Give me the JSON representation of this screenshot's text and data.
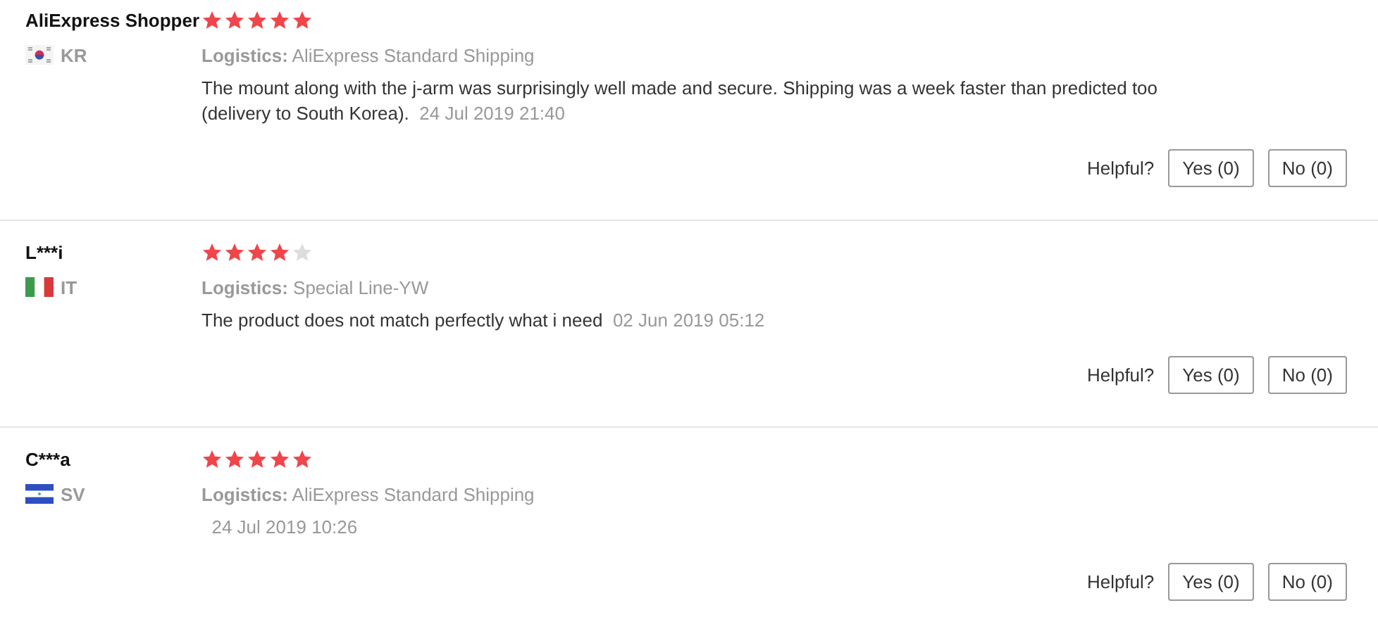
{
  "reviews": [
    {
      "name": "AliExpress Shopper",
      "stars": 5,
      "flag": {
        "kind": "kr"
      },
      "country": "KR",
      "logistics_label": "Logistics:",
      "logistics": "AliExpress Standard Shipping",
      "text": "The mount along with the j-arm was surprisingly well made and secure. Shipping was a week faster than predicted too (delivery to South Korea).",
      "date": "24 Jul 2019 21:40",
      "helpful_label": "Helpful?",
      "yes": "Yes (0)",
      "no": "No (0)"
    },
    {
      "name": "L***i",
      "stars": 4,
      "flag": {
        "kind": "it"
      },
      "country": "IT",
      "logistics_label": "Logistics:",
      "logistics": "Special Line-YW",
      "text": "The product does not match perfectly what i need",
      "date": "02 Jun 2019 05:12",
      "helpful_label": "Helpful?",
      "yes": "Yes (0)",
      "no": "No (0)"
    },
    {
      "name": "C***a",
      "stars": 5,
      "flag": {
        "kind": "sv"
      },
      "country": "SV",
      "logistics_label": "Logistics:",
      "logistics": "AliExpress Standard Shipping",
      "date": "24 Jul 2019 10:26",
      "helpful_label": "Helpful?",
      "yes": "Yes (0)",
      "no": "No (0)"
    }
  ]
}
